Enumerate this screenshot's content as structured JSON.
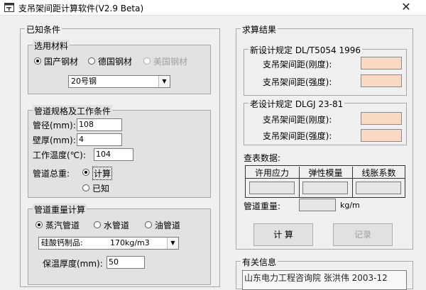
{
  "window": {
    "title": "支吊架间距计算软件(V2.9 Beta)",
    "close_glyph": "✕"
  },
  "known": {
    "legend": "已知条件",
    "material": {
      "legend": "选用材料",
      "options": [
        "国产钢材",
        "德国钢材",
        "美国钢材"
      ],
      "selected_index": 0,
      "grade": "20号钢"
    },
    "pipe": {
      "legend": "管道规格及工作条件",
      "diameter_label": "管径(mm):",
      "diameter": "108",
      "thickness_label": "壁厚(mm):",
      "thickness": "4",
      "temp_label": "工作温度(℃):",
      "temp": "104",
      "weight_label": "管道总重:",
      "weight_options": [
        "计算",
        "已知"
      ],
      "weight_selected_index": 0
    },
    "load": {
      "legend": "管道重量计算",
      "media": [
        "蒸汽管道",
        "水管道",
        "油管道"
      ],
      "media_selected_index": 0,
      "insulation": "硅酸钙制品:",
      "insulation_value": "170kg/m3",
      "thick_label": "保温厚度(mm):",
      "thick_value": "50"
    }
  },
  "result": {
    "legend": "求算结果",
    "new_spec": {
      "legend": "新设计规定  DL/T5054  1996",
      "rigid": "支吊架间距(刚度):",
      "strength": "支吊架间距(强度):"
    },
    "old_spec": {
      "legend": "老设计规定  DLGJ 23-81",
      "rigid": "支吊架间距(刚度):",
      "strength": "支吊架间距(强度):"
    },
    "table_title": "查表数据:",
    "table_headers": [
      "许用应力",
      "弹性模量",
      "线胀系数"
    ],
    "weight_label": "管道重量:",
    "weight_unit": "kg/m",
    "calc_button": "计 算",
    "record_button": "记录"
  },
  "info": {
    "legend": "有关信息",
    "text": "山东电力工程咨询院 张洪伟  2003-12"
  }
}
